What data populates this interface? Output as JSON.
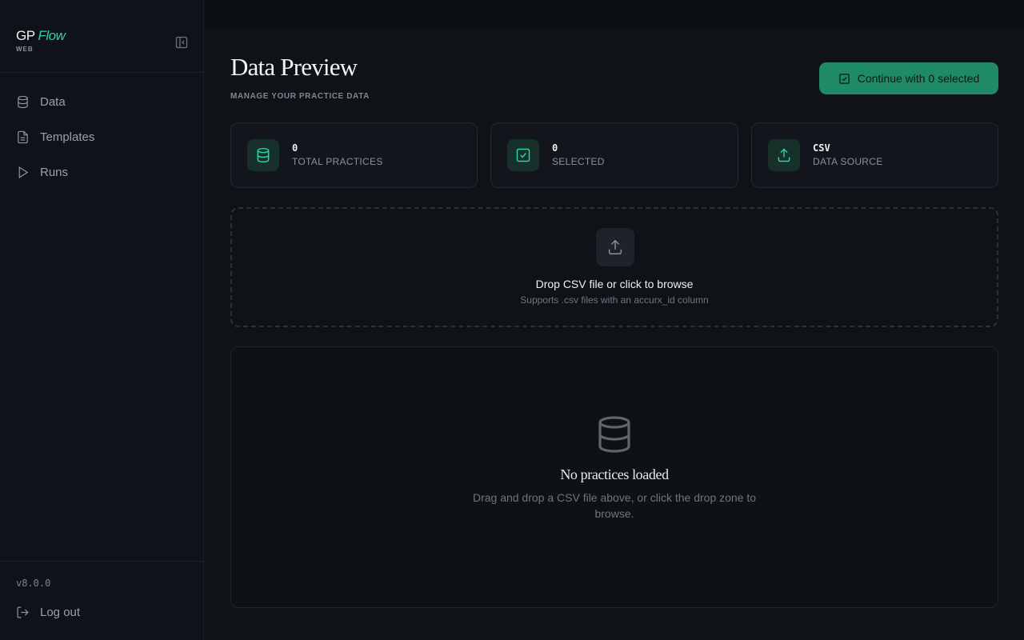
{
  "brand": {
    "gp": "GP",
    "flow": "Flow",
    "sub": "WEB"
  },
  "sidebar": {
    "items": [
      {
        "label": "Data",
        "icon": "database-icon"
      },
      {
        "label": "Templates",
        "icon": "file-text-icon"
      },
      {
        "label": "Runs",
        "icon": "play-icon"
      }
    ],
    "version": "v8.0.0",
    "logout_label": "Log out"
  },
  "header": {
    "title": "Data Preview",
    "subtitle": "MANAGE YOUR PRACTICE DATA",
    "continue_label": "Continue with 0 selected"
  },
  "stats": [
    {
      "value": "0",
      "label": "TOTAL PRACTICES",
      "icon": "database-icon"
    },
    {
      "value": "0",
      "label": "SELECTED",
      "icon": "check-square-icon"
    },
    {
      "value": "CSV",
      "label": "DATA SOURCE",
      "icon": "upload-icon"
    }
  ],
  "dropzone": {
    "title": "Drop CSV file or click to browse",
    "subtitle": "Supports .csv files with an accurx_id column"
  },
  "empty_state": {
    "title": "No practices loaded",
    "text": "Drag and drop a CSV file above, or click the drop zone to browse."
  },
  "colors": {
    "accent": "#2dd4a4",
    "button_bg": "#1e8a66",
    "background": "#0f1217"
  }
}
